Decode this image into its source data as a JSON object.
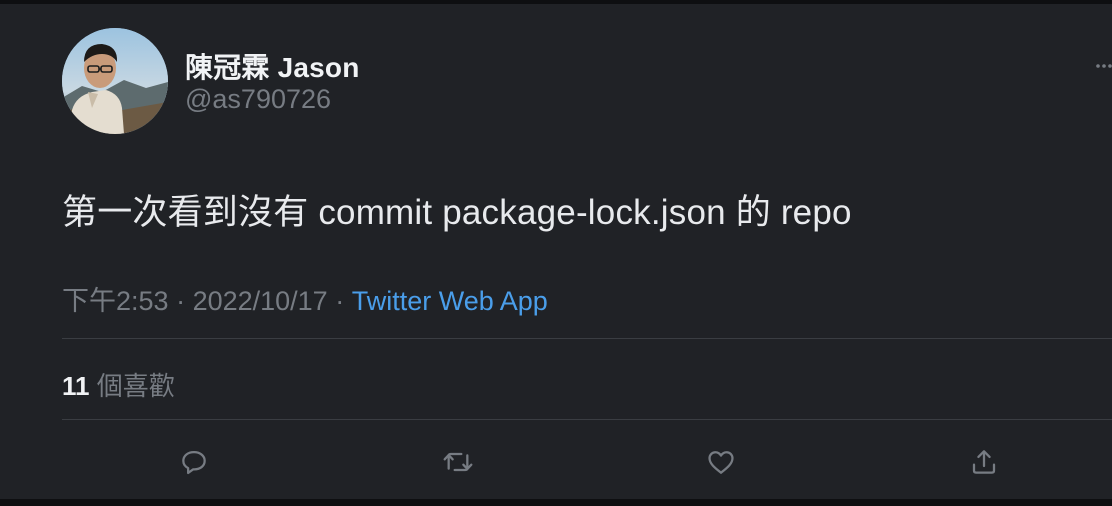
{
  "author": {
    "display_name": "陳冠霖 Jason",
    "handle": "@as790726",
    "avatar_icon": "avatar-photo"
  },
  "tweet": {
    "text": "第一次看到沒有 commit package-lock.json 的 repo"
  },
  "meta": {
    "time": "下午2:53",
    "separator": " · ",
    "date": "2022/10/17",
    "source": "Twitter Web App"
  },
  "stats": {
    "likes_count": "11",
    "likes_label": "個喜歡"
  },
  "actions": [
    {
      "name": "reply",
      "icon": "reply-icon"
    },
    {
      "name": "retweet",
      "icon": "retweet-icon"
    },
    {
      "name": "like",
      "icon": "heart-icon"
    },
    {
      "name": "share",
      "icon": "share-icon"
    }
  ],
  "colors": {
    "page_background": "#0e0f11",
    "card_background": "#202226",
    "primary_text": "#f1f3f5",
    "secondary_text": "#777c83",
    "link": "#4a9eea",
    "divider": "#3a3d42",
    "icon": "#777c83"
  }
}
